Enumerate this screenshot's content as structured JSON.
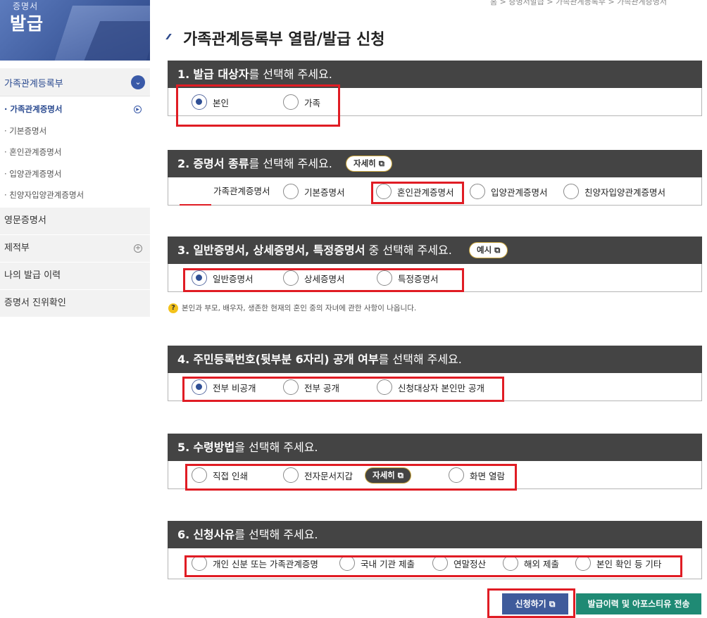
{
  "sidebar": {
    "banner_top": "증명서",
    "banner_main": "발급",
    "menu_head": "가족관계등록부",
    "sub_items": [
      {
        "label": "· 가족관계증명서"
      },
      {
        "label": "· 기본증명서"
      },
      {
        "label": "· 혼인관계증명서"
      },
      {
        "label": "· 입양관계증명서"
      },
      {
        "label": "· 친양자입양관계증명서"
      }
    ],
    "main_items": [
      {
        "label": "영문증명서"
      },
      {
        "label": "제적부"
      },
      {
        "label": "나의 발급 이력"
      },
      {
        "label": "증명서 진위확인"
      }
    ]
  },
  "breadcrumb": "홈 > 증명서발급 > 가족관계등록부 > 가족관계증명서",
  "page_title": "가족관계등록부 열람/발급 신청",
  "sections": [
    {
      "num": "1.",
      "bold": "발급 대상자",
      "rest": "를 선택해 주세요.",
      "options": [
        "본인",
        "가족"
      ]
    },
    {
      "num": "2.",
      "bold": "증명서 종류",
      "rest": "를 선택해 주세요.",
      "pill": "자세히",
      "options": [
        "가족관계증명서",
        "기본증명서",
        "혼인관계증명서",
        "입양관계증명서",
        "친양자입양관계증명서"
      ]
    },
    {
      "num": "3.",
      "bold": "일반증명서, 상세증명서, 특정증명서",
      "rest": " 중 선택해 주세요.",
      "pill": "예시",
      "options": [
        "일반증명서",
        "상세증명서",
        "특정증명서"
      ]
    },
    {
      "num": "4.",
      "bold": "주민등록번호(뒷부분 6자리) 공개 여부",
      "rest": "를 선택해 주세요.",
      "options": [
        "전부 비공개",
        "전부 공개",
        "신청대상자 본인만 공개"
      ]
    },
    {
      "num": "5.",
      "bold": "수령방법",
      "rest": "을 선택해 주세요.",
      "pill": "자세히",
      "options": [
        "직접 인쇄",
        "전자문서지갑",
        "화면 열람"
      ]
    },
    {
      "num": "6.",
      "bold": "신청사유",
      "rest": "를 선택해 주세요.",
      "options": [
        "개인 신분 또는 가족관계증명",
        "국내 기관 제출",
        "연말정산",
        "해외 제출",
        "본인 확인 등 기타"
      ]
    }
  ],
  "note": "본인과 부모, 배우자, 생존한 현재의 혼인 중의 자녀에 관한 사항이 나옵니다.",
  "buttons": {
    "apply": "신청하기",
    "history": "발급이력 및 아포스티유 전송"
  },
  "colors": {
    "section_header": "#444444",
    "accent_blue": "#2f4f95",
    "highlight_red": "#e01c24",
    "history_green": "#1f8a74"
  }
}
